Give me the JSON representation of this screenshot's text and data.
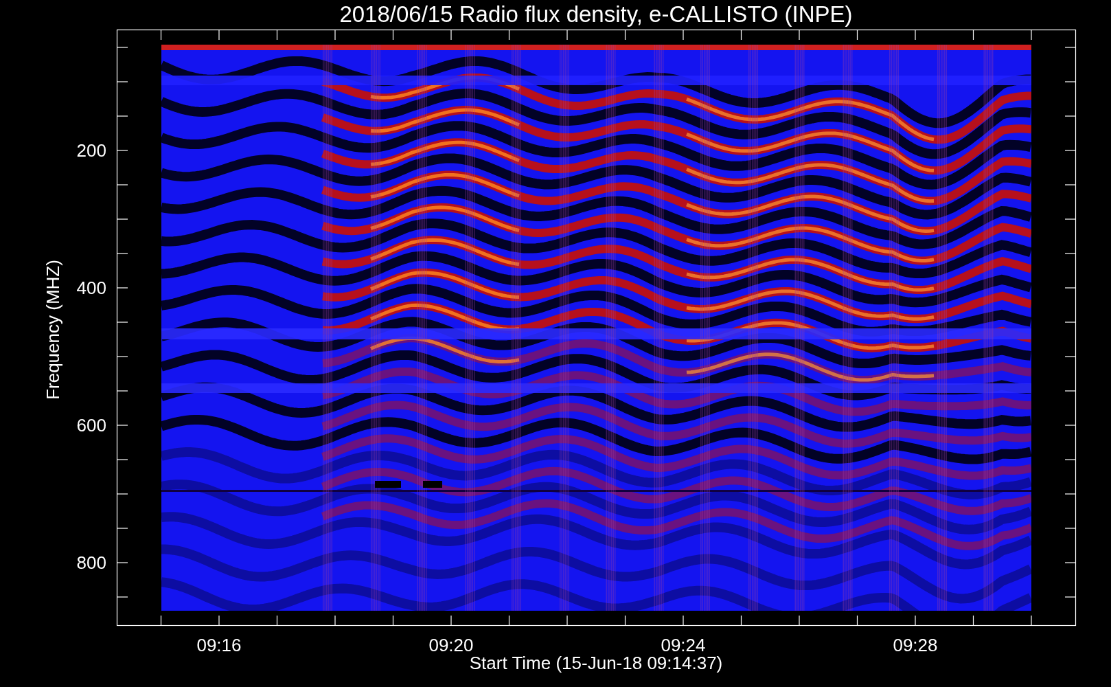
{
  "plot": {
    "title": "2018/06/15  Radio flux density, e-CALLISTO (INPE)",
    "ylabel": "Frequency (MHZ)",
    "xlabel": "Start Time (15-Jun-18 09:14:37)",
    "y_tick_labels": [
      "200",
      "400",
      "600",
      "800"
    ],
    "x_tick_labels": [
      "09:16",
      "09:20",
      "09:24",
      "09:28"
    ]
  }
}
